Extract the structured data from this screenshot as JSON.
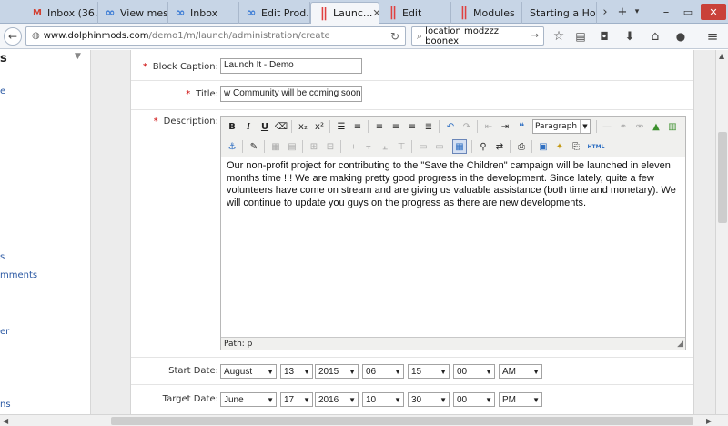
{
  "tabs": [
    {
      "label": "Inbox (36...",
      "icon": "gmail-icon"
    },
    {
      "label": "View mes...",
      "icon": "infinity-icon"
    },
    {
      "label": "Inbox",
      "icon": "infinity-icon"
    },
    {
      "label": "Edit Prod...",
      "icon": "infinity-icon"
    },
    {
      "label": "Launc...",
      "icon": "pipe-icon",
      "active": true
    },
    {
      "label": "Edit",
      "icon": "pipe-icon"
    },
    {
      "label": "Modules",
      "icon": "pipe-icon"
    },
    {
      "label": "Starting a Ho...",
      "icon": "none"
    }
  ],
  "url": {
    "host": "www.dolphinmods.com",
    "path": "/demo1/m/launch/administration/create"
  },
  "search": {
    "value": "location modzzz boonex"
  },
  "sidebar": {
    "heading": "s",
    "items": [
      "e",
      "s",
      "mments",
      "er",
      "ns"
    ]
  },
  "form": {
    "block_caption": {
      "label": "Block Caption:",
      "value": "Launch It - Demo"
    },
    "title": {
      "label": "Title:",
      "value": "w Community will be coming soon !"
    },
    "description": {
      "label": "Description:",
      "format": "Paragraph",
      "content": "Our non-profit project for contributing to the \"Save the Children\" campaign will be launched in eleven months time !!! We are making pretty good progress in the development. Since lately, quite a few volunteers have come on stream and are giving us valuable assistance (both time and monetary). We will continue to update you guys on the progress as there are new developments.",
      "path": "Path: p"
    },
    "start_date": {
      "label": "Start Date:",
      "month": "August",
      "day": "13",
      "year": "2015",
      "hour": "06",
      "minute": "15",
      "second": "00",
      "ampm": "AM"
    },
    "target_date": {
      "label": "Target Date:",
      "month": "June",
      "day": "17",
      "year": "2016",
      "hour": "10",
      "minute": "30",
      "second": "00",
      "ampm": "PM"
    }
  },
  "colors": {
    "link": "#2a58a3",
    "required": "#cc0000",
    "tabbar": "#c7d5e6"
  }
}
